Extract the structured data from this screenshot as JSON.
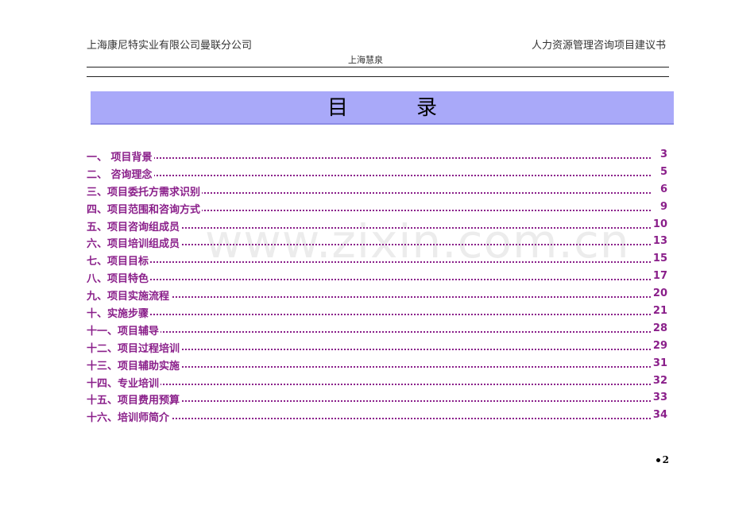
{
  "header": {
    "company": "上海康尼特实业有限公司曼联分公司",
    "document_title": "人力资源管理咨询项目建议书",
    "subheading": "上海慧泉"
  },
  "title": {
    "char1": "目",
    "char2": "录"
  },
  "toc": [
    {
      "label": "一、  项目背景",
      "page": "3"
    },
    {
      "label": "二、  咨询理念",
      "page": "5"
    },
    {
      "label": "三、项目委托方需求识别",
      "page": "6"
    },
    {
      "label": "四、项目范围和咨询方式",
      "page": "9"
    },
    {
      "label": "五、项目咨询组成员",
      "page": "10"
    },
    {
      "label": "六、项目培训组成员",
      "page": "13"
    },
    {
      "label": "七、项目目标",
      "page": "15"
    },
    {
      "label": "八、项目特色",
      "page": "17"
    },
    {
      "label": "九、项目实施流程",
      "page": "20"
    },
    {
      "label": "十、实施步骤",
      "page": "21"
    },
    {
      "label": "十一、项目辅导",
      "page": "28"
    },
    {
      "label": "十二、项目过程培训",
      "page": "29"
    },
    {
      "label": "十三、项目辅助实施",
      "page": "31"
    },
    {
      "label": "十四、专业培训",
      "page": "32"
    },
    {
      "label": "十五、项目费用预算",
      "page": "33"
    },
    {
      "label": "十六、培训师简介",
      "page": "34"
    }
  ],
  "watermark": "www.zixin.com.cn",
  "footer": {
    "page_number": "2"
  }
}
